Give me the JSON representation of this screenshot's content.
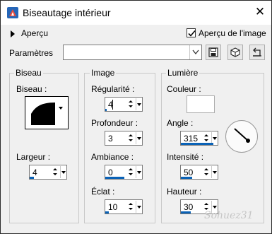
{
  "window": {
    "title": "Biseautage intérieur",
    "close_glyph": "✕",
    "icons": {
      "app": "psp-effect-icon",
      "close": "close-icon"
    }
  },
  "preview": {
    "toggle_label": "Aperçu",
    "checkbox_label": "Aperçu de l'image",
    "checkbox_checked": true
  },
  "presets": {
    "label": "Paramètres",
    "value": "",
    "buttons": [
      "save-preset-icon",
      "cube-icon",
      "reset-icon"
    ]
  },
  "biseau": {
    "title": "Biseau",
    "shape_label": "Biseau :",
    "width_label": "Largeur :",
    "width_value": "4"
  },
  "image": {
    "title": "Image",
    "smoothness_label": "Régularité :",
    "smoothness_value": "4",
    "depth_label": "Profondeur :",
    "depth_value": "3",
    "ambience_label": "Ambiance :",
    "ambience_value": "0",
    "shine_label": "Éclat :",
    "shine_value": "10"
  },
  "lumiere": {
    "title": "Lumière",
    "color_label": "Couleur :",
    "color_value": "#ffffff",
    "angle_label": "Angle :",
    "angle_value": "315",
    "intensity_label": "Intensité :",
    "intensity_value": "50",
    "height_label": "Hauteur :",
    "height_value": "30"
  },
  "colors": {
    "accent": "#0a62b6",
    "window_bg": "#f0f0f0"
  },
  "watermark": "Sohuez31"
}
